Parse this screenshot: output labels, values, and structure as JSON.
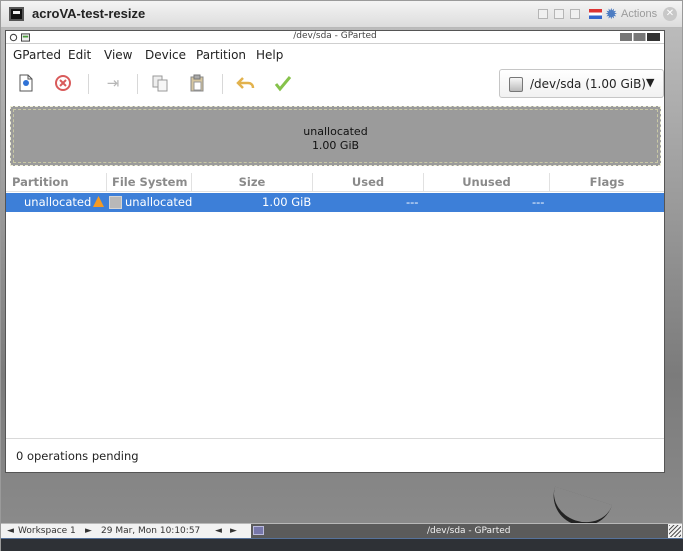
{
  "vm": {
    "title": "acroVA-test-resize",
    "actions_label": "Actions",
    "icons": [
      "vm-app-icon",
      "scale-icon",
      "fullscreen-icon",
      "window-icon",
      "keyboard-flag-icon",
      "gear-icon",
      "close-icon"
    ]
  },
  "gparted": {
    "window_title": "/dev/sda - GParted",
    "menu": [
      "GParted",
      "Edit",
      "View",
      "Device",
      "Partition",
      "Help"
    ],
    "toolbar_icons": [
      "new-partition-icon",
      "delete-icon",
      "resize-move-icon",
      "copy-icon",
      "paste-icon",
      "undo-icon",
      "apply-icon"
    ],
    "device_selector": "/dev/sda (1.00 GiB)",
    "visual_map": {
      "label": "unallocated",
      "size": "1.00 GiB"
    },
    "table": {
      "columns": [
        "Partition",
        "File System",
        "Size",
        "Used",
        "Unused",
        "Flags"
      ],
      "rows": [
        {
          "partition": "unallocated",
          "file_system": "unallocated",
          "size": "1.00 GiB",
          "used": "---",
          "unused": "---",
          "flags": ""
        }
      ]
    },
    "status": "0 operations pending"
  },
  "panel": {
    "workspace_label": "Workspace 1",
    "clock": "29 Mar, Mon 10:10:57",
    "task_label": "/dev/sda - GParted"
  },
  "colors": {
    "selection": "#3d7fd8",
    "unallocated_visual": "#9b9b9b",
    "warning": "#f59a23"
  }
}
